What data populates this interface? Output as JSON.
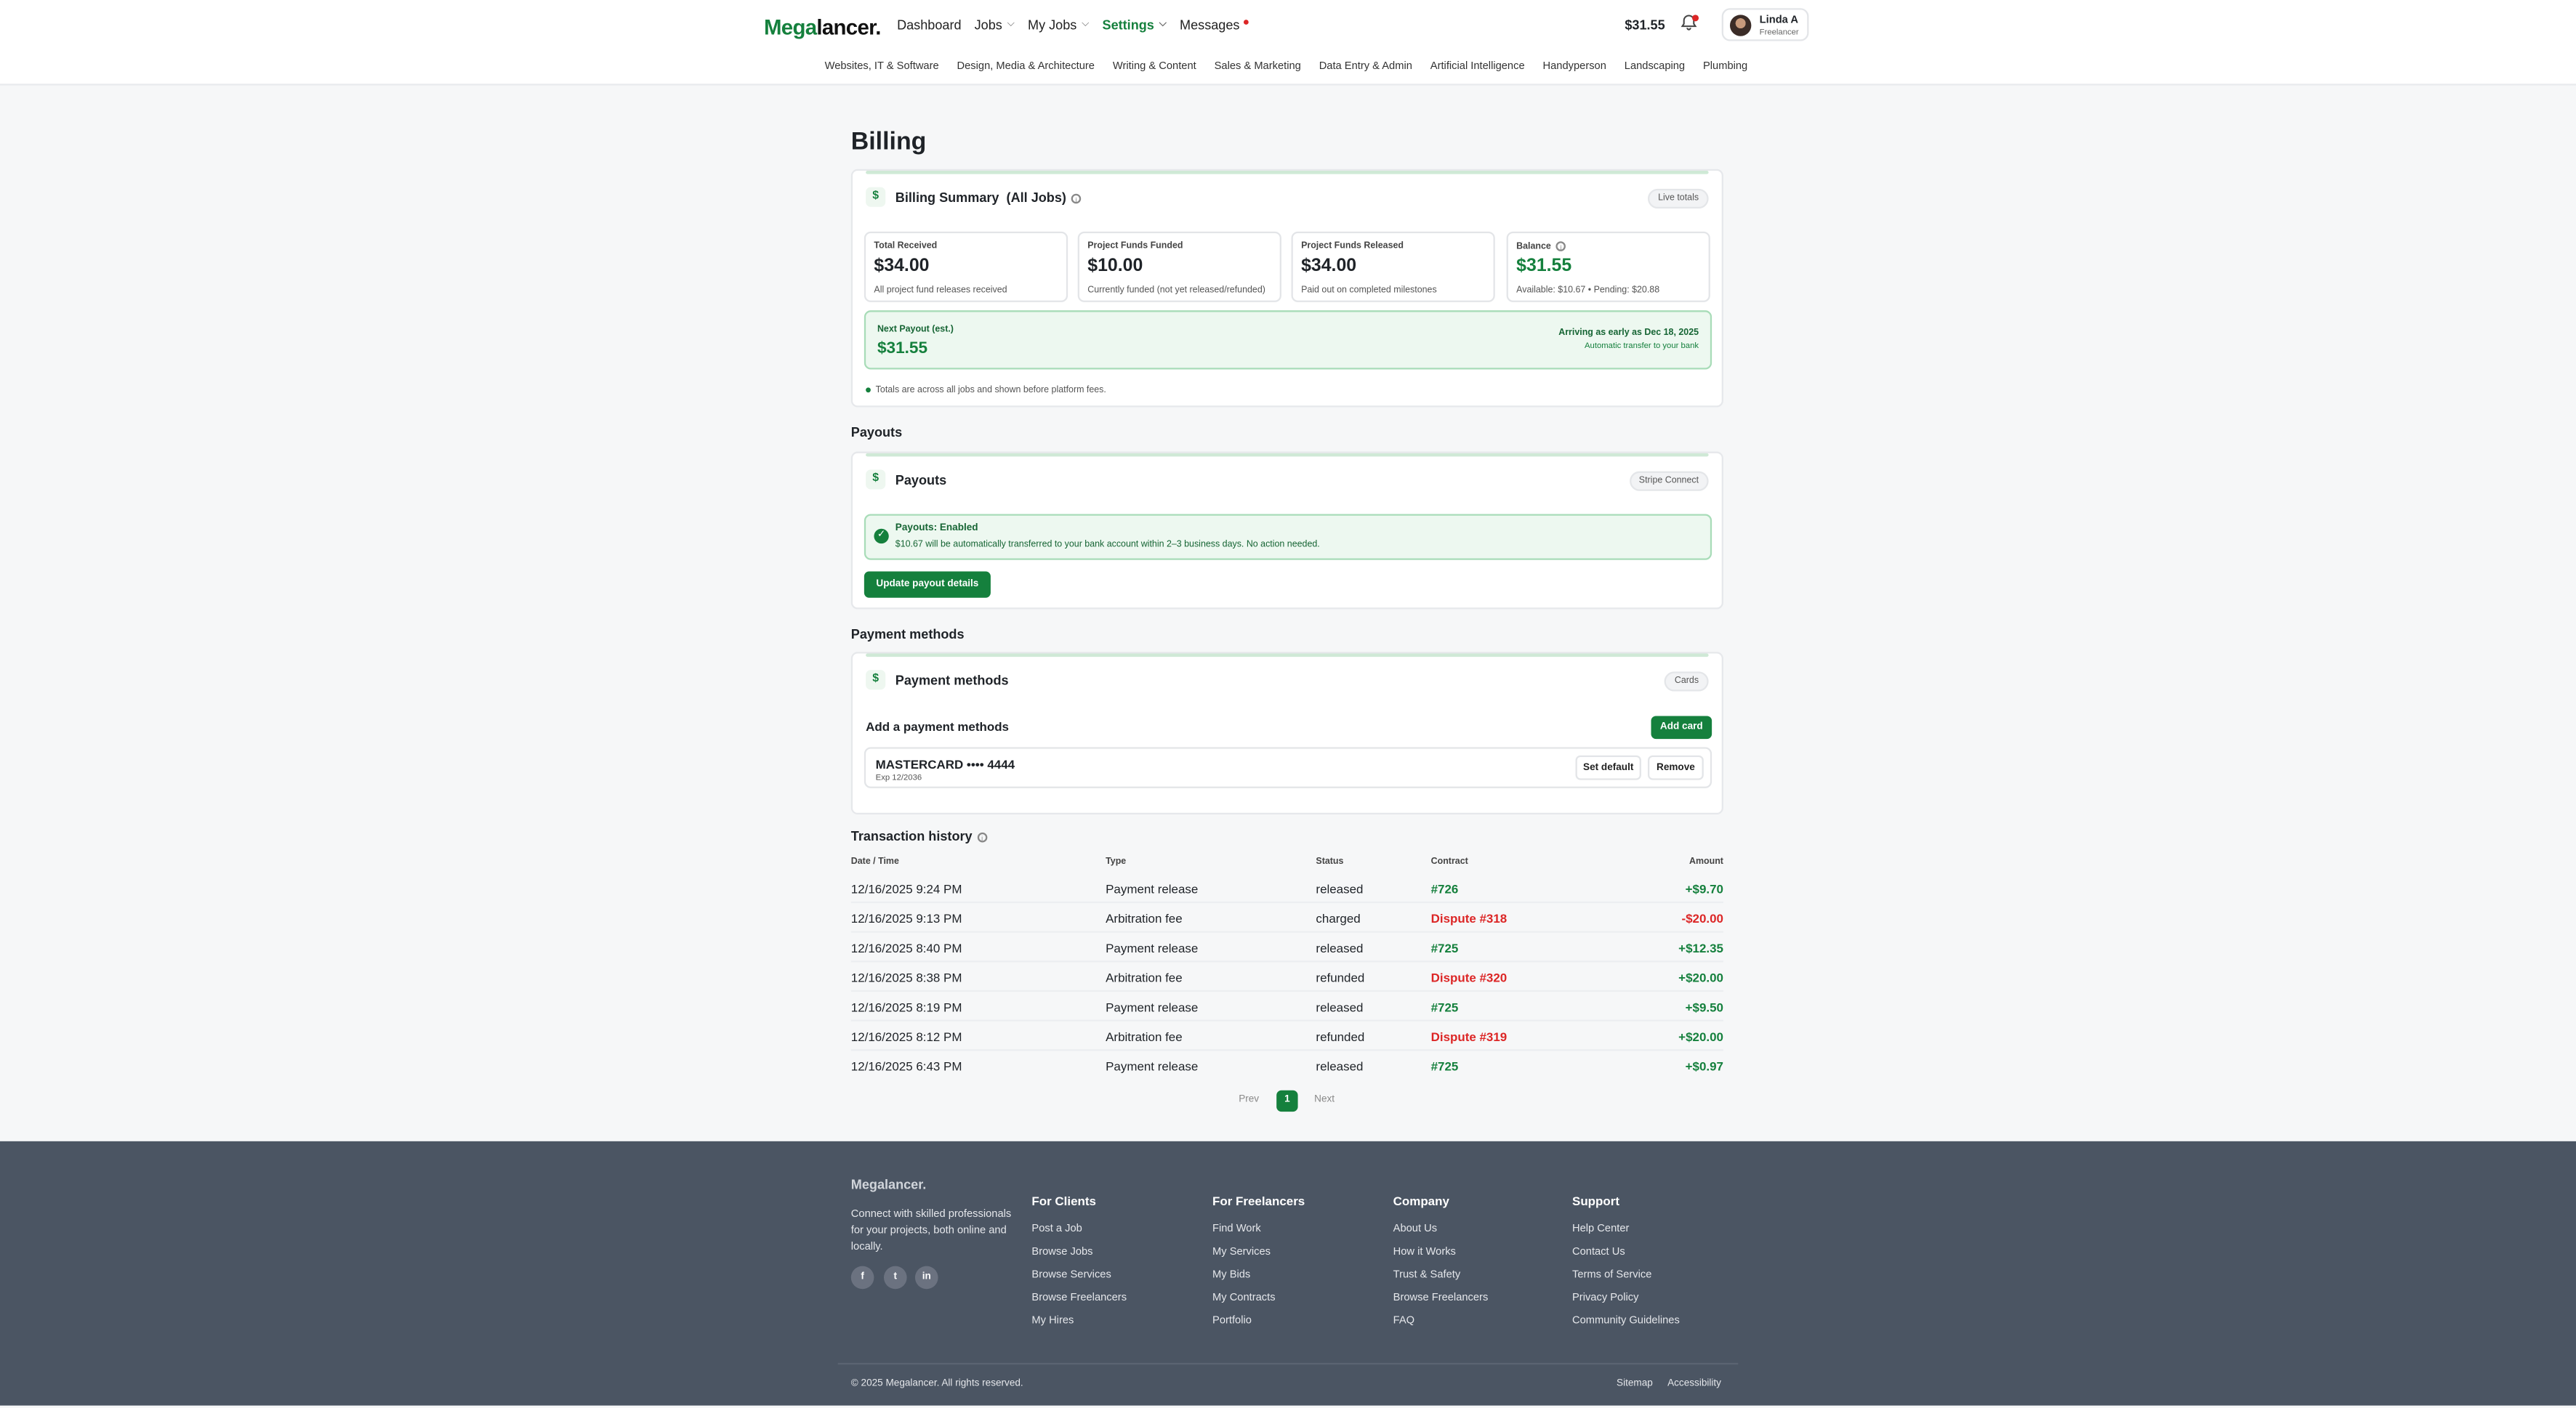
{
  "header": {
    "logo_a": "Mega",
    "logo_b": "lancer.",
    "nav": {
      "dashboard": "Dashboard",
      "jobs": "Jobs",
      "my_jobs": "My Jobs",
      "settings": "Settings",
      "messages": "Messages"
    },
    "balance": "$31.55",
    "user": {
      "name": "Linda A",
      "role": "Freelancer"
    }
  },
  "categories": [
    "Websites, IT & Software",
    "Design, Media & Architecture",
    "Writing & Content",
    "Sales & Marketing",
    "Data Entry & Admin",
    "Artificial Intelligence",
    "Handyperson",
    "Landscaping",
    "Plumbing"
  ],
  "page_title": "Billing",
  "summary": {
    "title": "Billing Summary",
    "scope": "(All Jobs)",
    "pill": "Live totals",
    "stats": [
      {
        "label": "Total Received",
        "value": "$34.00",
        "sub": "All project fund releases received"
      },
      {
        "label": "Project Funds Funded",
        "value": "$10.00",
        "sub": "Currently funded (not yet released/refunded)"
      },
      {
        "label": "Project Funds Released",
        "value": "$34.00",
        "sub": "Paid out on completed milestones"
      },
      {
        "label": "Balance",
        "value": "$31.55",
        "sub": "Available: $10.67 • Pending: $20.88"
      }
    ],
    "next_payout": {
      "label": "Next Payout (est.)",
      "value": "$31.55",
      "arriving": "Arriving as early as Dec 18, 2025",
      "auto": "Automatic transfer to your bank"
    },
    "note": "Totals are across all jobs and shown before platform fees."
  },
  "payouts": {
    "section": "Payouts",
    "title": "Payouts",
    "pill": "Stripe Connect",
    "status_title": "Payouts: Enabled",
    "status_desc": "$10.67 will be automatically transferred to your bank account within 2–3 business days. No action needed.",
    "button": "Update payout details"
  },
  "payment_methods": {
    "section": "Payment methods",
    "title": "Payment methods",
    "pill": "Cards",
    "add_title": "Add a payment methods",
    "add_button": "Add card",
    "card": {
      "brand": "MASTERCARD •••• 4444",
      "exp": "Exp 12/2036"
    },
    "set_default": "Set default",
    "remove": "Remove"
  },
  "transactions": {
    "title": "Transaction history",
    "headers": {
      "date": "Date / Time",
      "type": "Type",
      "status": "Status",
      "contract": "Contract",
      "amount": "Amount"
    },
    "rows": [
      {
        "date": "12/16/2025 9:24 PM",
        "type": "Payment release",
        "status": "released",
        "contract": "#726",
        "amount": "+$9.70"
      },
      {
        "date": "12/16/2025 9:13 PM",
        "type": "Arbitration fee",
        "status": "charged",
        "contract": "Dispute #318",
        "amount": "-$20.00"
      },
      {
        "date": "12/16/2025 8:40 PM",
        "type": "Payment release",
        "status": "released",
        "contract": "#725",
        "amount": "+$12.35"
      },
      {
        "date": "12/16/2025 8:38 PM",
        "type": "Arbitration fee",
        "status": "refunded",
        "contract": "Dispute #320",
        "amount": "+$20.00"
      },
      {
        "date": "12/16/2025 8:19 PM",
        "type": "Payment release",
        "status": "released",
        "contract": "#725",
        "amount": "+$9.50"
      },
      {
        "date": "12/16/2025 8:12 PM",
        "type": "Arbitration fee",
        "status": "refunded",
        "contract": "Dispute #319",
        "amount": "+$20.00"
      },
      {
        "date": "12/16/2025 6:43 PM",
        "type": "Payment release",
        "status": "released",
        "contract": "#725",
        "amount": "+$0.97"
      }
    ],
    "pager": {
      "prev": "Prev",
      "page": "1",
      "next": "Next"
    }
  },
  "footer": {
    "logo": "Megalancer.",
    "desc": "Connect with skilled professionals for your projects, both online and locally.",
    "social": [
      "f",
      "t",
      "in"
    ],
    "columns": [
      {
        "h": "For Clients",
        "links": [
          "Post a Job",
          "Browse Jobs",
          "Browse Services",
          "Browse Freelancers",
          "My Hires"
        ]
      },
      {
        "h": "For Freelancers",
        "links": [
          "Find Work",
          "My Services",
          "My Bids",
          "My Contracts",
          "Portfolio"
        ]
      },
      {
        "h": "Company",
        "links": [
          "About Us",
          "How it Works",
          "Trust & Safety",
          "Browse Freelancers",
          "FAQ"
        ]
      },
      {
        "h": "Support",
        "links": [
          "Help Center",
          "Contact Us",
          "Terms of Service",
          "Privacy Policy",
          "Community Guidelines"
        ]
      }
    ],
    "copyright": "© 2025 Megalancer. All rights reserved.",
    "sitemap": "Sitemap",
    "accessibility": "Accessibility"
  },
  "colors": {
    "brand_green": "#15803d",
    "negative_red": "#dc2626",
    "footer_bg": "#4b5563"
  }
}
